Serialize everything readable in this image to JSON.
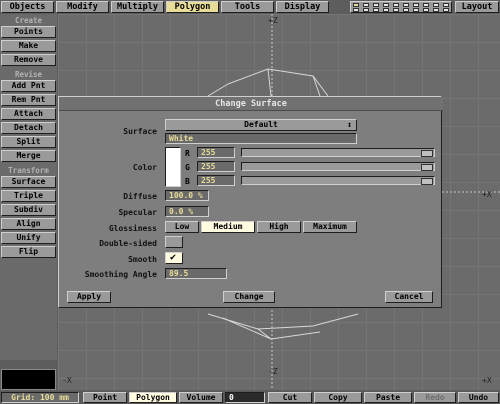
{
  "menu": {
    "tabs": [
      "Objects",
      "Modify",
      "Multiply",
      "Polygon",
      "Tools",
      "Display"
    ],
    "active_tab": "Polygon",
    "layout_label": "Layout"
  },
  "toolbar": {
    "create_label": "Create",
    "create_items": [
      "Points",
      "Make",
      "Remove"
    ],
    "revise_label": "Revise",
    "revise_items": [
      "Add Pnt",
      "Rem Pnt",
      "Attach",
      "Detach",
      "Split",
      "Merge"
    ],
    "transform_label": "Transform",
    "transform_items": [
      "Surface",
      "Triple",
      "Subdiv",
      "Align",
      "Unify",
      "Flip"
    ]
  },
  "viewport": {
    "axis_top": "+Z",
    "axis_right": "+X",
    "axis_left_bottom": "-X",
    "axis_bottom": "-Z",
    "axis_right_bottom": "+X"
  },
  "dialog": {
    "title": "Change Surface",
    "surface_label": "Surface",
    "surface_value": "Default",
    "surface_name": "White",
    "color_label": "Color",
    "color_swatch": "#ffffff",
    "channels": [
      {
        "name": "R",
        "value": "255"
      },
      {
        "name": "G",
        "value": "255"
      },
      {
        "name": "B",
        "value": "255"
      }
    ],
    "diffuse_label": "Diffuse",
    "diffuse_value": "100.0 %",
    "specular_label": "Specular",
    "specular_value": "0.0 %",
    "glossiness_label": "Glossiness",
    "glossiness_options": [
      "Low",
      "Medium",
      "High",
      "Maximum"
    ],
    "glossiness_selected": "Medium",
    "double_sided_label": "Double-sided",
    "double_sided_checked": false,
    "smooth_label": "Smooth",
    "smooth_checked": true,
    "smoothing_angle_label": "Smoothing Angle",
    "smoothing_angle_value": "89.5",
    "apply_label": "Apply",
    "change_label": "Change",
    "cancel_label": "Cancel"
  },
  "bottom": {
    "grid_label": "Grid: 100 mm",
    "modes": [
      "Point",
      "Polygon",
      "Volume"
    ],
    "active_mode": "Polygon",
    "count": "0",
    "actions": [
      "Cut",
      "Copy",
      "Paste",
      "Redo",
      "Undo"
    ],
    "disabled_actions": [
      "Redo"
    ]
  },
  "colors": {
    "accent": "#e8dd98",
    "button": "#9a9a9a",
    "selected": "#fffbe0"
  }
}
